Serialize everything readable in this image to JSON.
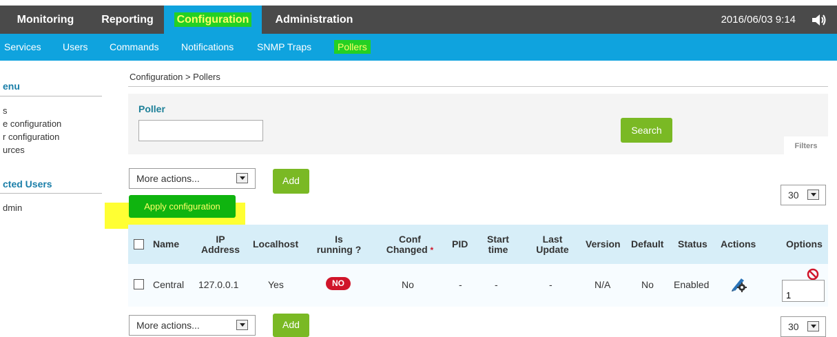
{
  "topnav": {
    "items": [
      "Monitoring",
      "Reporting",
      "Configuration",
      "Administration"
    ],
    "datetime": "2016/06/03 9:14"
  },
  "subnav": {
    "items": [
      "Services",
      "Users",
      "Commands",
      "Notifications",
      "SNMP Traps",
      "Pollers"
    ]
  },
  "sidebar": {
    "menu_heading": "enu",
    "menu_items": [
      "s",
      "e configuration",
      "r configuration",
      "urces"
    ],
    "users_heading": "cted Users",
    "users": [
      "dmin"
    ]
  },
  "breadcrumb": "Configuration  >  Pollers",
  "filter": {
    "poller_label": "Poller",
    "poller_value": "",
    "search_label": "Search",
    "filters_tab": "Filters"
  },
  "actions": {
    "more_actions": "More actions...",
    "add_label": "Add",
    "apply_label": "Apply configuration",
    "limit_value": "30"
  },
  "table": {
    "columns": {
      "name": "Name",
      "ip1": "IP",
      "ip2": "Address",
      "localhost": "Localhost",
      "running1": "Is",
      "running2": "running ?",
      "conf1": "Conf",
      "conf2": "Changed",
      "conf_marker": "*",
      "pid": "PID",
      "start1": "Start",
      "start2": "time",
      "update1": "Last",
      "update2": "Update",
      "version": "Version",
      "default": "Default",
      "status": "Status",
      "actions": "Actions",
      "options": "Options"
    },
    "row": {
      "name": "Central",
      "ip": "127.0.0.1",
      "localhost": "Yes",
      "running": "NO",
      "conf_changed": "No",
      "pid": "-",
      "start_time": "-",
      "last_update": "-",
      "version": "N/A",
      "default": "No",
      "status": "Enabled",
      "options_value": "1"
    }
  },
  "colors": {
    "topbar": "#4a4a4a",
    "accent": "#0fa3de",
    "highlight_green": "#24d024",
    "highlight_yellow": "#ffff33",
    "button_green": "#7ab924",
    "badge_red": "#d0152a"
  }
}
